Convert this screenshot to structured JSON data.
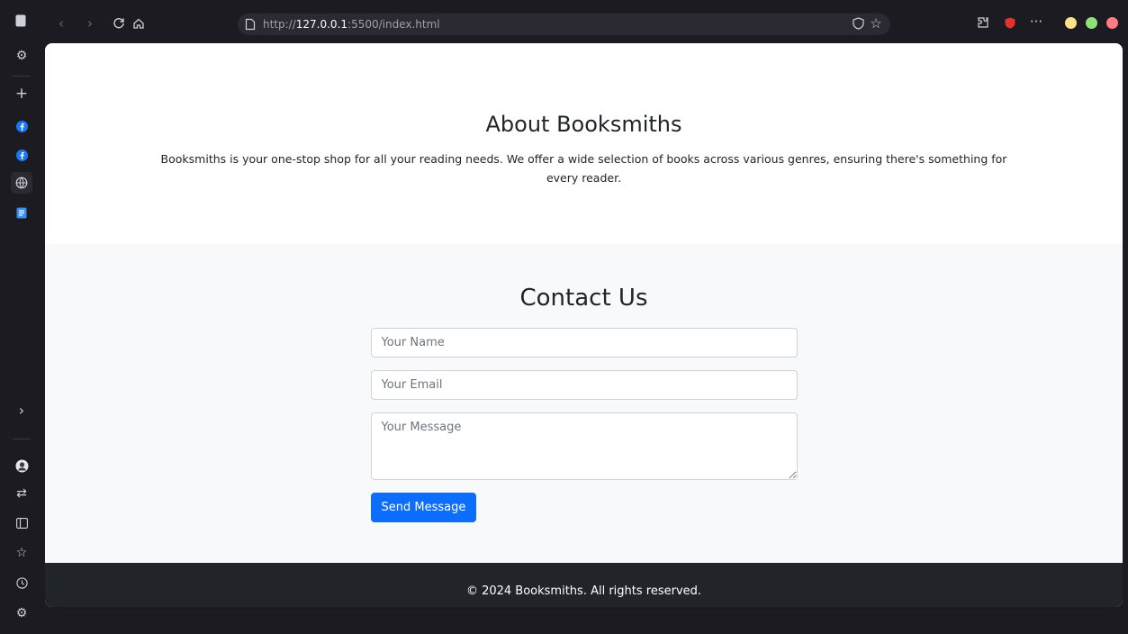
{
  "browser": {
    "url_scheme": "http://",
    "url_host": "127.0.0.1",
    "url_rest": ":5500/index.html"
  },
  "about": {
    "title": "About Booksmiths",
    "text": "Booksmiths is your one-stop shop for all your reading needs. We offer a wide selection of books across various genres, ensuring there's something for every reader."
  },
  "contact": {
    "title": "Contact Us",
    "name_placeholder": "Your Name",
    "email_placeholder": "Your Email",
    "message_placeholder": "Your Message",
    "send_label": "Send Message"
  },
  "footer": {
    "text": "© 2024 Booksmiths. All rights reserved."
  }
}
